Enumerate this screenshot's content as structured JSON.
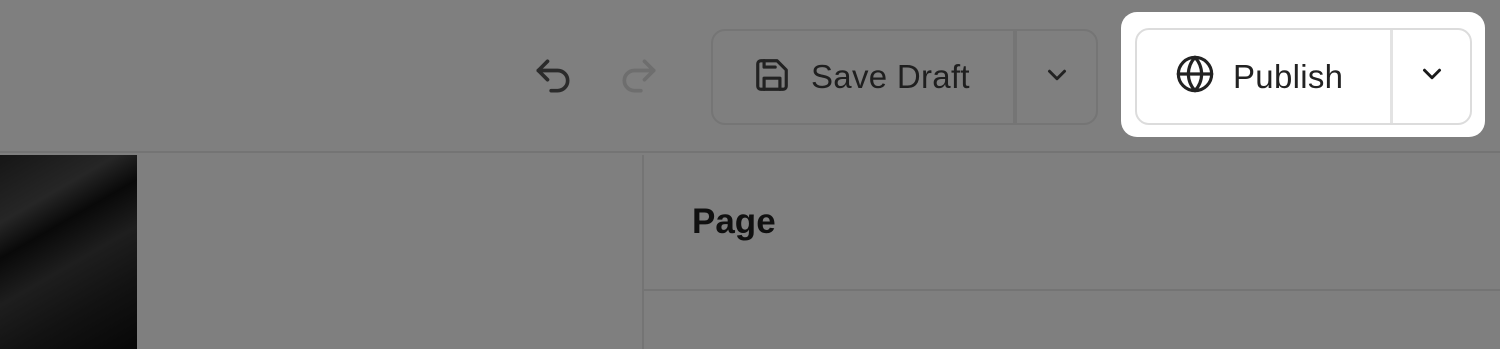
{
  "toolbar": {
    "undo_icon": "undo-icon",
    "redo_icon": "redo-icon",
    "save_draft": {
      "icon": "save-icon",
      "label": "Save Draft",
      "menu_icon": "chevron-down-icon"
    },
    "publish": {
      "icon": "globe-icon",
      "label": "Publish",
      "menu_icon": "chevron-down-icon"
    }
  },
  "panel": {
    "title": "Page"
  },
  "colors": {
    "overlay": "#7f7f7f",
    "spotlight": "#ffffff",
    "text": "#1f1f1f"
  }
}
